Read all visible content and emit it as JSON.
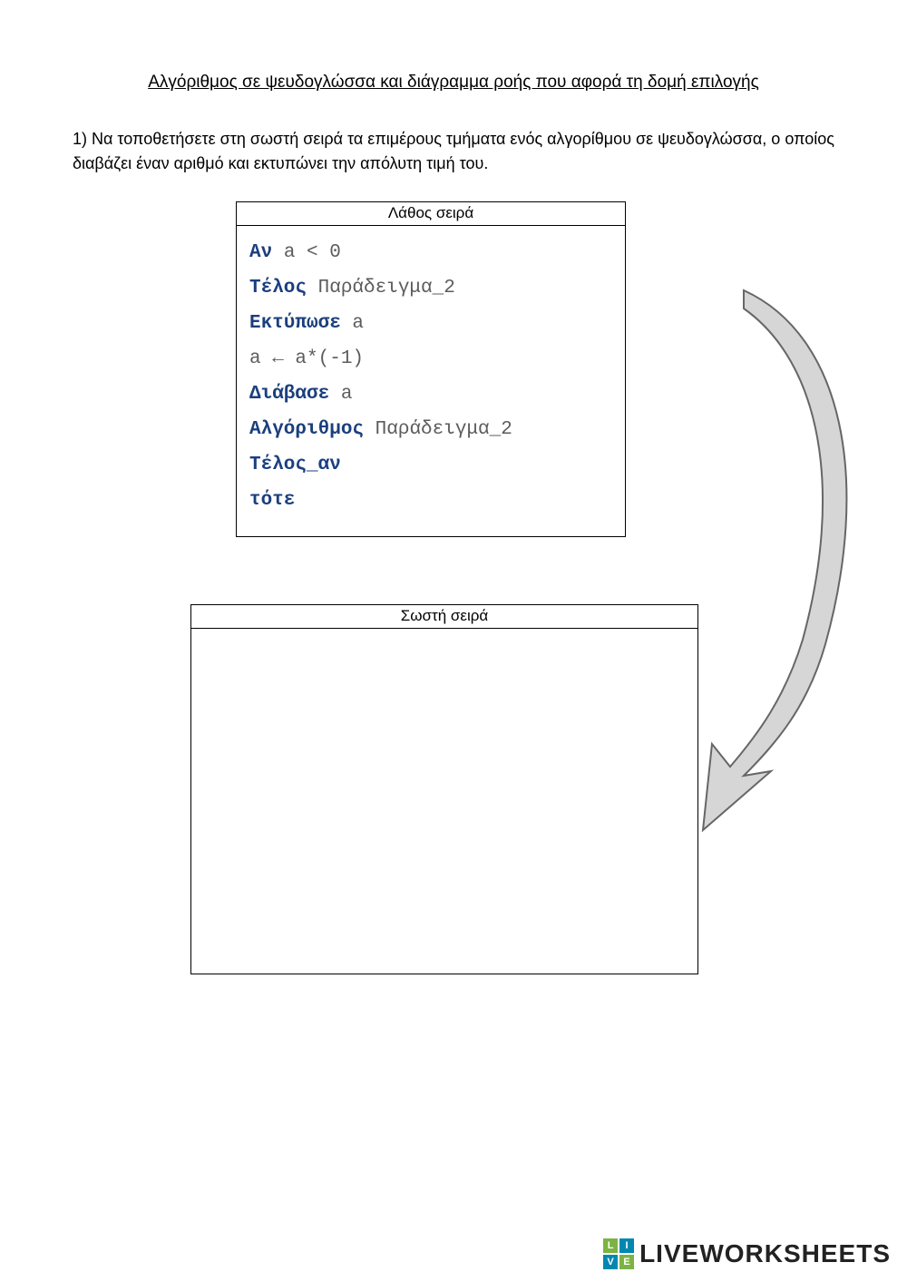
{
  "title": "Αλγόριθμος σε ψευδογλώσσα και διάγραμμα ροής που αφορά  τη δομή επιλογής",
  "instruction": "1) Να τοποθετήσετε στη σωστή σειρά τα επιμέρους τμήματα ενός αλγορίθμου σε ψευδογλώσσα, ο οποίος διαβάζει έναν αριθμό και εκτυπώνει την απόλυτη τιμή του.",
  "wrong_header": "Λάθος σειρά",
  "correct_header": "Σωστή σειρά",
  "items": [
    {
      "kw": "Αν",
      "rest": " a < 0"
    },
    {
      "kw": "Τέλος",
      "rest": " Παράδειγμα_2"
    },
    {
      "kw": "Εκτύπωσε",
      "rest": " a"
    },
    {
      "kw": "",
      "rest": "a ← a*(-1)"
    },
    {
      "kw": "Διάβασε",
      "rest": " a"
    },
    {
      "kw": "Αλγόριθμος",
      "rest": " Παράδειγμα_2"
    },
    {
      "kw": "Τέλος_αν",
      "rest": ""
    },
    {
      "kw": "τότε",
      "rest": ""
    }
  ],
  "watermark": {
    "sq": [
      "L",
      "I",
      "V",
      "E"
    ],
    "text": "LIVEWORKSHEETS"
  }
}
